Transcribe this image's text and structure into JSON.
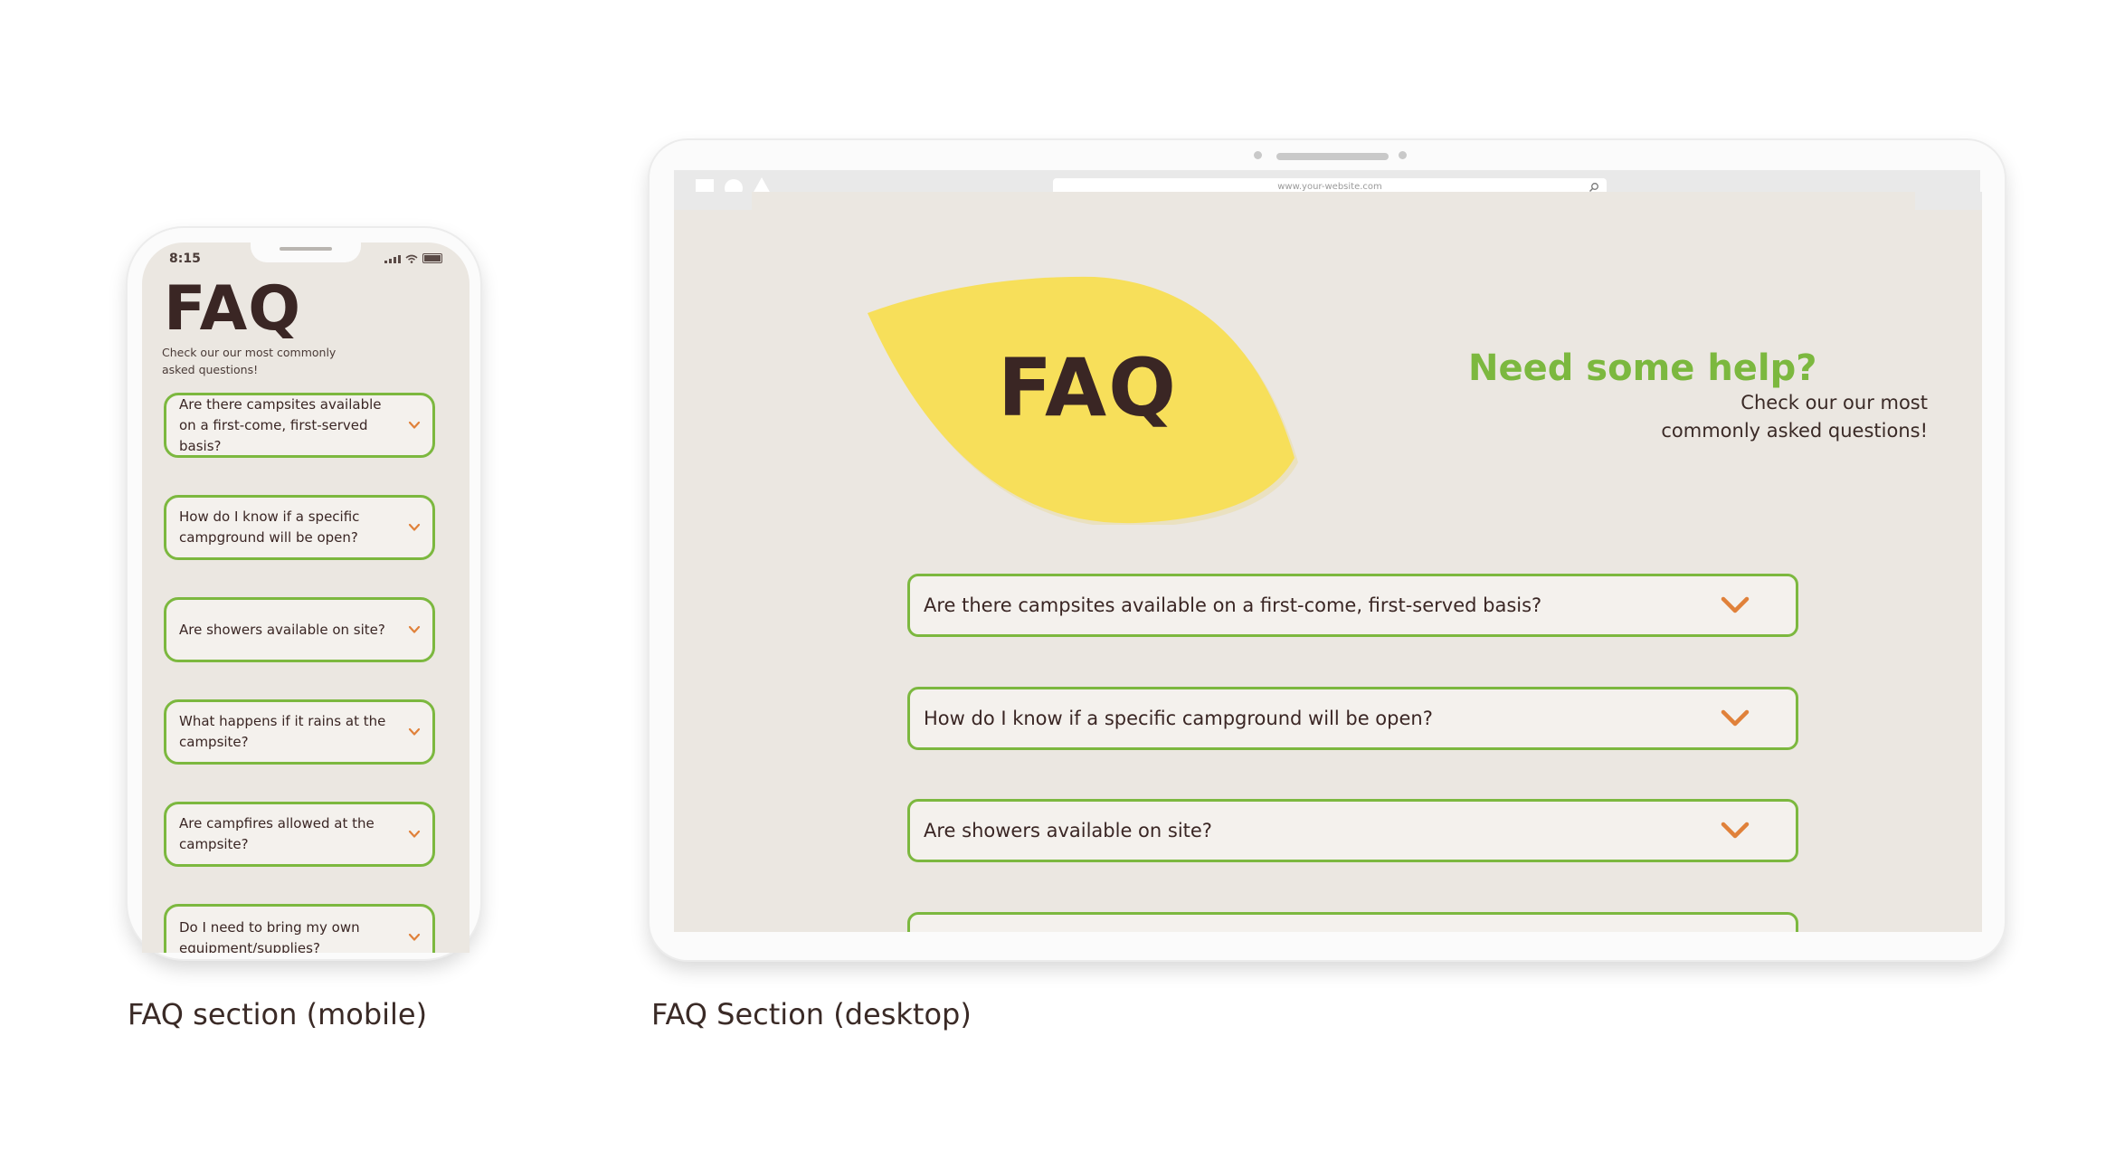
{
  "mobile": {
    "time": "8:15",
    "title": "FAQ",
    "subtitle": "Check our our most commonly asked questions!",
    "questions": [
      "Are there campsites available on a first-come, first-served basis?",
      "How do I know if a specific campground will be open?",
      "Are showers available on site?",
      "What happens if it rains at the campsite?",
      "Are campfires allowed at the campsite?",
      "Do I need to bring my own equipment/supplies?"
    ],
    "caption": "FAQ section (mobile)"
  },
  "desktop": {
    "url": "www.your-website.com",
    "title": "FAQ",
    "heading": "Need some help?",
    "subtitle_line1": "Check our our most",
    "subtitle_line2": "commonly asked questions!",
    "questions": [
      "Are there campsites available on a first-come, first-served basis?",
      "How do I know if a specific campground will be open?",
      "Are showers available on site?",
      ""
    ],
    "caption": "FAQ Section (desktop)"
  },
  "colors": {
    "accent_green": "#7cb83f",
    "chevron_orange": "#e0813a",
    "leaf_yellow": "#f7df5a",
    "background": "#ebe7e1",
    "text_dark": "#3a2624"
  },
  "icons": [
    "chevron-down-icon",
    "search-icon",
    "signal-icon",
    "wifi-icon",
    "battery-icon"
  ]
}
